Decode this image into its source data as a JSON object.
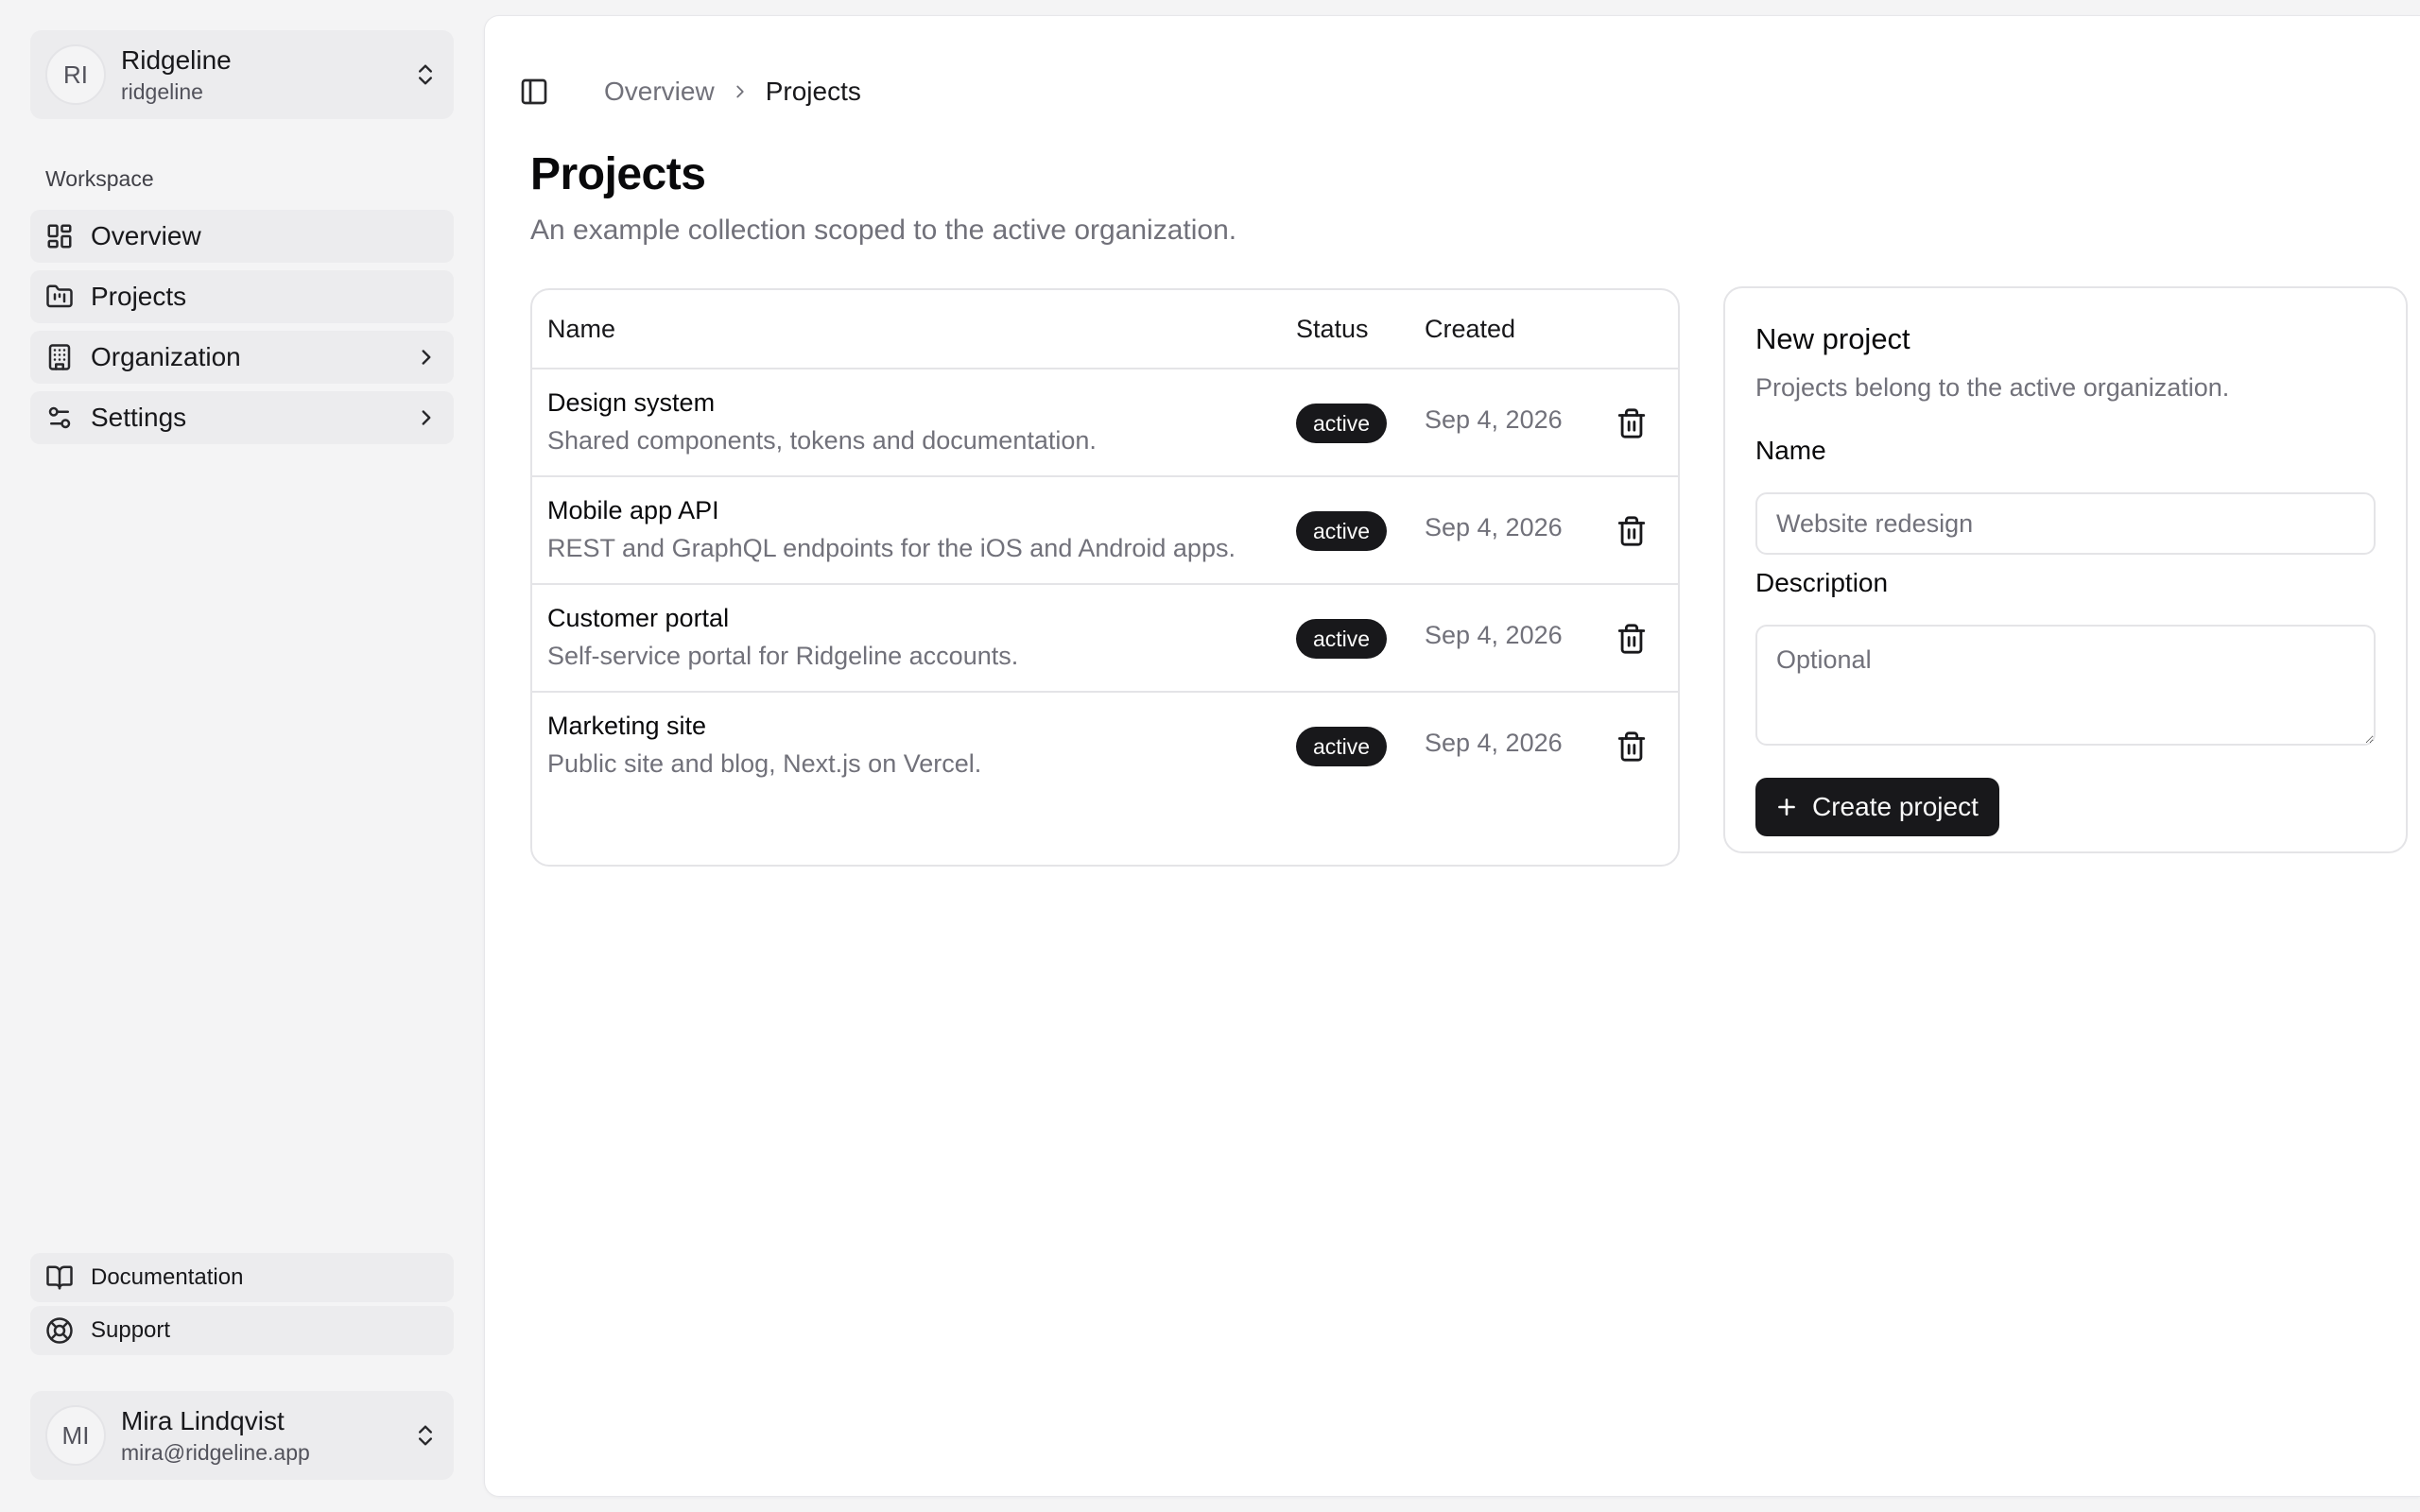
{
  "org": {
    "initials": "RI",
    "name": "Ridgeline",
    "slug": "ridgeline"
  },
  "sidebar": {
    "group_label": "Workspace",
    "items": [
      {
        "label": "Overview",
        "icon": "dashboard-icon"
      },
      {
        "label": "Projects",
        "icon": "folder-kanban-icon"
      },
      {
        "label": "Organization",
        "icon": "building-icon",
        "has_submenu": true
      },
      {
        "label": "Settings",
        "icon": "sliders-icon",
        "has_submenu": true
      }
    ],
    "footer": [
      {
        "label": "Documentation",
        "icon": "book-icon"
      },
      {
        "label": "Support",
        "icon": "lifebuoy-icon"
      }
    ]
  },
  "user": {
    "initials": "MI",
    "name": "Mira Lindqvist",
    "email": "mira@ridgeline.app"
  },
  "breadcrumb": {
    "parent": "Overview",
    "current": "Projects"
  },
  "page": {
    "title": "Projects",
    "description": "An example collection scoped to the active organization."
  },
  "table": {
    "columns": {
      "name": "Name",
      "status": "Status",
      "created": "Created"
    },
    "rows": [
      {
        "name": "Design system",
        "description": "Shared components, tokens and documentation.",
        "status": "active",
        "created": "Sep 4, 2026"
      },
      {
        "name": "Mobile app API",
        "description": "REST and GraphQL endpoints for the iOS and Android apps.",
        "status": "active",
        "created": "Sep 4, 2026"
      },
      {
        "name": "Customer portal",
        "description": "Self-service portal for Ridgeline accounts.",
        "status": "active",
        "created": "Sep 4, 2026"
      },
      {
        "name": "Marketing site",
        "description": "Public site and blog, Next.js on Vercel.",
        "status": "active",
        "created": "Sep 4, 2026"
      }
    ]
  },
  "form": {
    "title": "New project",
    "description": "Projects belong to the active organization.",
    "name_label": "Name",
    "name_value": "",
    "name_placeholder": "Website redesign",
    "description_label": "Description",
    "description_value": "",
    "description_placeholder": "Optional",
    "submit_label": "Create project"
  },
  "colors": {
    "background": "#f4f4f5",
    "surface": "#ffffff",
    "primary": "#18181b",
    "muted_text": "#71717a",
    "border": "#e4e4e7"
  }
}
